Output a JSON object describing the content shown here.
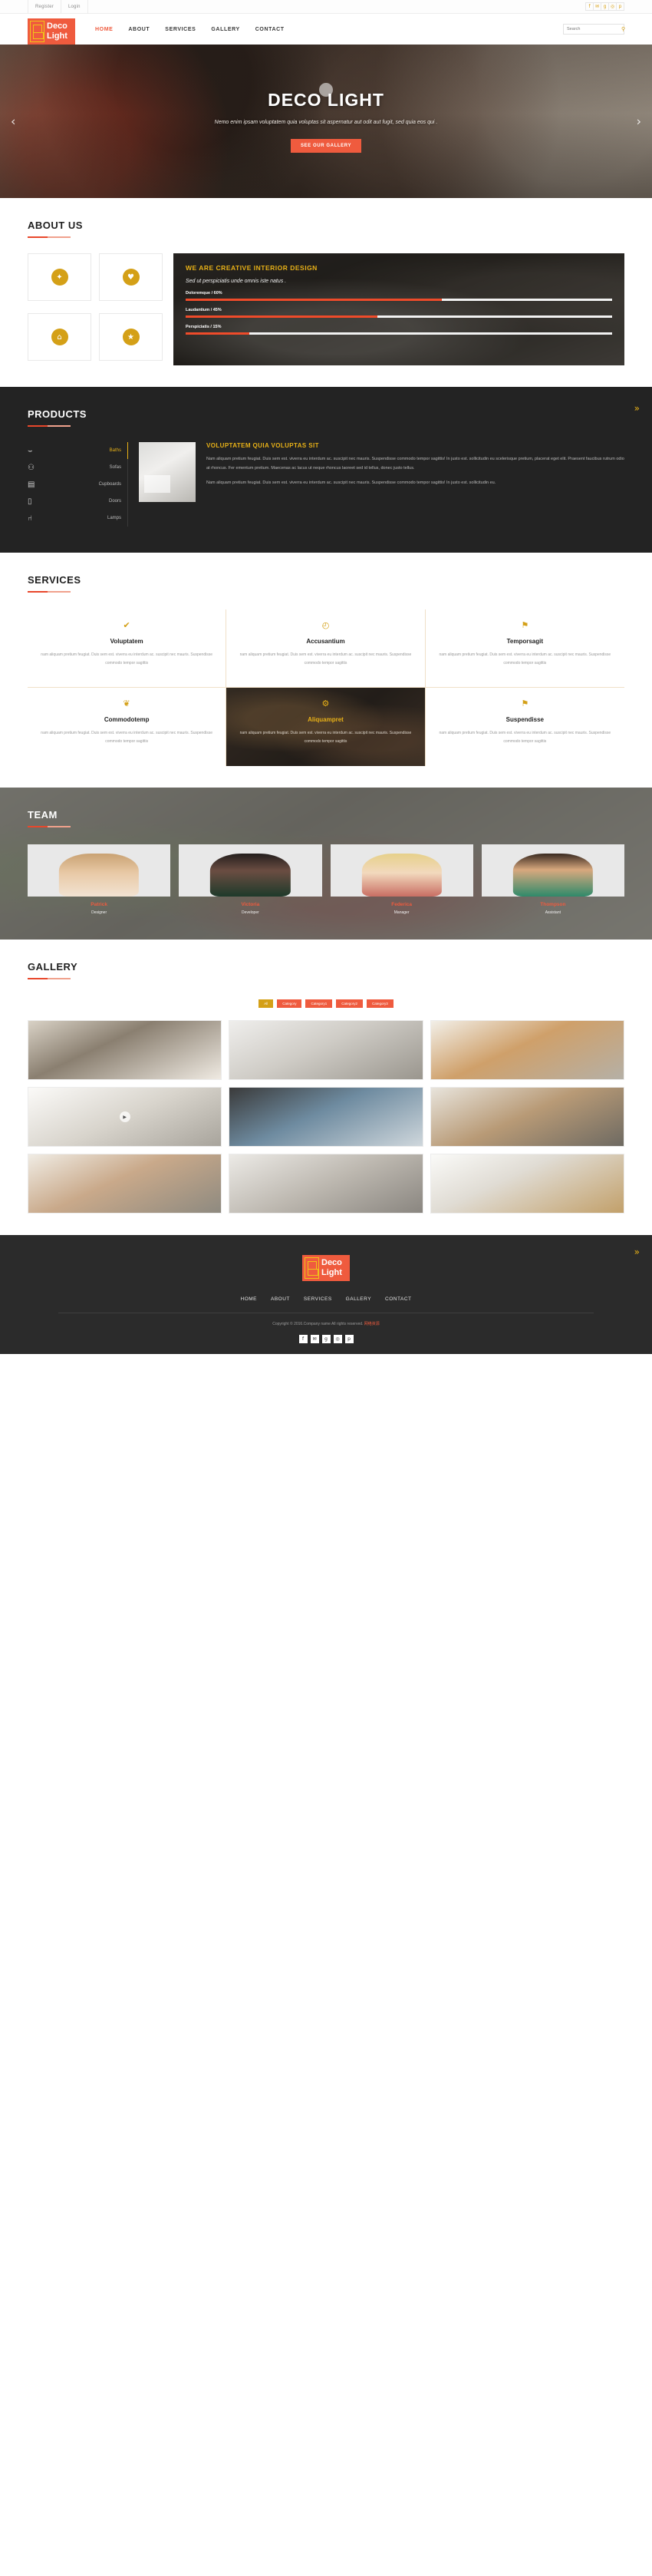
{
  "topbar": {
    "register": "Register",
    "login": "Login",
    "social": [
      {
        "name": "facebook-icon",
        "glyph": "f"
      },
      {
        "name": "twitter-icon",
        "glyph": "✉"
      },
      {
        "name": "google-plus-icon",
        "glyph": "g"
      },
      {
        "name": "dribbble-icon",
        "glyph": "◎"
      },
      {
        "name": "pinterest-icon",
        "glyph": "p"
      }
    ]
  },
  "brand": {
    "line1": "Deco",
    "line2": "Light"
  },
  "nav": {
    "items": [
      "HOME",
      "ABOUT",
      "SERVICES",
      "GALLERY",
      "CONTACT"
    ],
    "active": "HOME"
  },
  "search": {
    "placeholder": "Search",
    "value": ""
  },
  "hero": {
    "title": "DECO LIGHT",
    "subtitle": "Nemo enim ipsam voluptatem quia voluptas sit aspernatur aut odit aut fugit, sed quia eos qui .",
    "button": "SEE OUR GALLERY",
    "prev": "‹",
    "next": "›"
  },
  "about": {
    "title": "ABOUT US",
    "icons": [
      {
        "name": "lightbulb-icon",
        "glyph": "✦"
      },
      {
        "name": "heart-icon",
        "glyph": "♥"
      },
      {
        "name": "home-icon",
        "glyph": "⌂"
      },
      {
        "name": "star-icon",
        "glyph": "★"
      }
    ],
    "panel_title": "WE ARE CREATIVE INTERIOR DESIGN",
    "panel_sub": "Sed ut perspiciatis unde omnis iste natus .",
    "skills": [
      {
        "label": "Doloremque / 60%",
        "value": 60
      },
      {
        "label": "Laudantium / 45%",
        "value": 45
      },
      {
        "label": "Perspiciatis / 15%",
        "value": 15
      }
    ]
  },
  "products": {
    "title": "PRODUCTS",
    "tabs": [
      {
        "label": "Baths",
        "icon": "bathtub-icon",
        "glyph": "⌣",
        "active": true
      },
      {
        "label": "Sofas",
        "icon": "sofa-icon",
        "glyph": "⚇",
        "active": false
      },
      {
        "label": "Cupboards",
        "icon": "cupboard-icon",
        "glyph": "▤",
        "active": false
      },
      {
        "label": "Doors",
        "icon": "door-icon",
        "glyph": "▯",
        "active": false
      },
      {
        "label": "Lamps",
        "icon": "lamp-icon",
        "glyph": "⑁",
        "active": false
      }
    ],
    "heading": "VOLUPTATEM QUIA VOLUPTAS SIT",
    "paragraph1": "Nam aliquam pretium feugiat. Duis sem est. viverra eu interdum ac. suscipit nec mauris. Suspendisse commodo tempor sagittis! In justo est. sollicitudin eu scelerisque pretium, placerat eget elit. Praesent faucibus rutrum odio at rhoncus. Fer ementum pretium. Maecenas ac lacus ut neque rhoncus laoreet sed id tellus, donec justo tellus.",
    "paragraph2": "Nam aliquam pretium feugiat. Duis sem est. viverra eu interdum ac. suscipit nec mauris. Suspendisse commodo tempor sagittis! In justo est. sollicitudin eu.",
    "scroll_top": "»"
  },
  "services": {
    "title": "SERVICES",
    "body": "nam aliquam pretium feugiat. Duis sem est. viverra eu interdum ac. suscipit nec mauris. Suspendisse commodo tempor sagittis",
    "items": [
      {
        "name": "Voluptatem",
        "icon": "check-icon",
        "glyph": "✔",
        "featured": false
      },
      {
        "name": "Accusantium",
        "icon": "clock-icon",
        "glyph": "◴",
        "featured": false
      },
      {
        "name": "Temporsagit",
        "icon": "map-pin-icon",
        "glyph": "⚑",
        "featured": false
      },
      {
        "name": "Commodotemp",
        "icon": "leaf-icon",
        "glyph": "❦",
        "featured": false
      },
      {
        "name": "Aliquampret",
        "icon": "gear-icon",
        "glyph": "⚙",
        "featured": true
      },
      {
        "name": "Suspendisse",
        "icon": "pin-icon",
        "glyph": "⚑",
        "featured": false
      }
    ]
  },
  "team": {
    "title": "TEAM",
    "members": [
      {
        "name": "Patrick",
        "role": "Designer"
      },
      {
        "name": "Victoria",
        "role": "Developer"
      },
      {
        "name": "Federica",
        "role": "Manager"
      },
      {
        "name": "Thompson",
        "role": "Assistant"
      }
    ]
  },
  "gallery": {
    "title": "GALLERY",
    "filters": [
      "All",
      "Category",
      "Category1",
      "Category2",
      "Category3"
    ],
    "active_filter": "All",
    "items": [
      {
        "name": "gallery-item-1",
        "has_play": false
      },
      {
        "name": "gallery-item-2",
        "has_play": false
      },
      {
        "name": "gallery-item-3",
        "has_play": false
      },
      {
        "name": "gallery-item-4",
        "has_play": true
      },
      {
        "name": "gallery-item-5",
        "has_play": false
      },
      {
        "name": "gallery-item-6",
        "has_play": false
      },
      {
        "name": "gallery-item-7",
        "has_play": false
      },
      {
        "name": "gallery-item-8",
        "has_play": false
      },
      {
        "name": "gallery-item-9",
        "has_play": false
      }
    ],
    "play_glyph": "▶"
  },
  "footer": {
    "brand": {
      "line1": "Deco",
      "line2": "Light"
    },
    "nav": [
      "HOME",
      "ABOUT",
      "SERVICES",
      "GALLERY",
      "CONTACT"
    ],
    "copyright": "Copyright © 2016.Company name All rights reserved.",
    "copyright_mark": "网络资源",
    "social": [
      {
        "name": "facebook-icon",
        "glyph": "f"
      },
      {
        "name": "twitter-icon",
        "glyph": "✉"
      },
      {
        "name": "google-plus-icon",
        "glyph": "g"
      },
      {
        "name": "dribbble-icon",
        "glyph": "◎"
      },
      {
        "name": "pinterest-icon",
        "glyph": "p"
      }
    ],
    "scroll_top": "»"
  },
  "colors": {
    "accent_orange": "#ef5b3e",
    "accent_gold": "#d4a017",
    "dark": "#232323",
    "bar_red": "#ef4b2a"
  }
}
